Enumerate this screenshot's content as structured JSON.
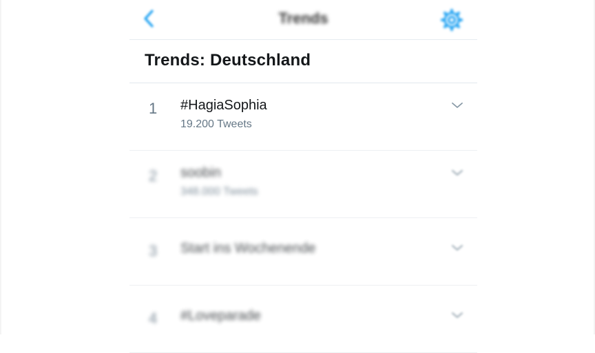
{
  "nav": {
    "title": "Trends",
    "back_icon": "chevron-left-icon",
    "settings_icon": "gear-icon",
    "accent_color": "#1da1f2"
  },
  "heading": "Trends: Deutschland",
  "trends": [
    {
      "rank": "1",
      "name": "#HagiaSophia",
      "count": "19.200 Tweets"
    },
    {
      "rank": "2",
      "name": "soobin",
      "count": "348.000 Tweets"
    },
    {
      "rank": "3",
      "name": "Start ins Wochenende",
      "count": ""
    },
    {
      "rank": "4",
      "name": "#Loveparade",
      "count": ""
    }
  ],
  "colors": {
    "text_primary": "#14171a",
    "text_secondary": "#657786",
    "divider": "#e6ecf0"
  }
}
